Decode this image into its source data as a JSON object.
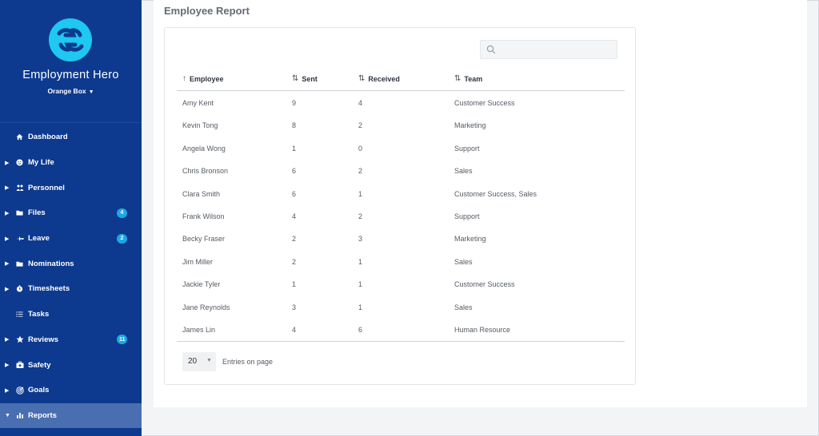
{
  "sidebar": {
    "brand": "Employment Hero",
    "org": "Orange Box",
    "items": [
      {
        "label": "Dashboard",
        "icon": "home-icon",
        "arrow": false,
        "badge": ""
      },
      {
        "label": "My Life",
        "icon": "smiley-icon",
        "arrow": true,
        "badge": ""
      },
      {
        "label": "Personnel",
        "icon": "people-icon",
        "arrow": true,
        "badge": ""
      },
      {
        "label": "Files",
        "icon": "folder-icon",
        "arrow": true,
        "badge": "4"
      },
      {
        "label": "Leave",
        "icon": "plane-icon",
        "arrow": true,
        "badge": "2"
      },
      {
        "label": "Nominations",
        "icon": "folder-icon",
        "arrow": true,
        "badge": ""
      },
      {
        "label": "Timesheets",
        "icon": "clock-icon",
        "arrow": true,
        "badge": ""
      },
      {
        "label": "Tasks",
        "icon": "list-icon",
        "arrow": false,
        "badge": ""
      },
      {
        "label": "Reviews",
        "icon": "star-icon",
        "arrow": true,
        "badge": "11"
      },
      {
        "label": "Safety",
        "icon": "first-aid-icon",
        "arrow": true,
        "badge": ""
      },
      {
        "label": "Goals",
        "icon": "target-icon",
        "arrow": true,
        "badge": ""
      },
      {
        "label": "Reports",
        "icon": "bar-chart-icon",
        "arrow": true,
        "badge": "",
        "active": true
      }
    ]
  },
  "main": {
    "title": "Employee Report",
    "search": {
      "value": "",
      "placeholder": ""
    },
    "columns": [
      "Employee",
      "Sent",
      "Received",
      "Team"
    ],
    "rows": [
      [
        "Amy Kent",
        "9",
        "4",
        "Customer Success"
      ],
      [
        "Kevin Tong",
        "8",
        "2",
        "Marketing"
      ],
      [
        "Angela Wong",
        "1",
        "0",
        "Support"
      ],
      [
        "Chris Bronson",
        "6",
        "2",
        "Sales"
      ],
      [
        "Clara Smith",
        "6",
        "1",
        "Customer Success, Sales"
      ],
      [
        "Frank Wilson",
        "4",
        "2",
        "Support"
      ],
      [
        "Becky Fraser",
        "2",
        "3",
        "Marketing"
      ],
      [
        "Jim Miller",
        "2",
        "1",
        "Sales"
      ],
      [
        "Jackie Tyler",
        "1",
        "1",
        "Customer Success"
      ],
      [
        "Jane Reynolds",
        "3",
        "1",
        "Sales"
      ],
      [
        "James Lin",
        "4",
        "6",
        "Human Resource"
      ]
    ],
    "pager": {
      "value": "20",
      "label": "Entries on page"
    }
  },
  "colors": {
    "sidebar": "#0d3a8e",
    "active": "#4a6fb0",
    "badge": "#1ea7e6",
    "logo": "#1ec8f0"
  }
}
